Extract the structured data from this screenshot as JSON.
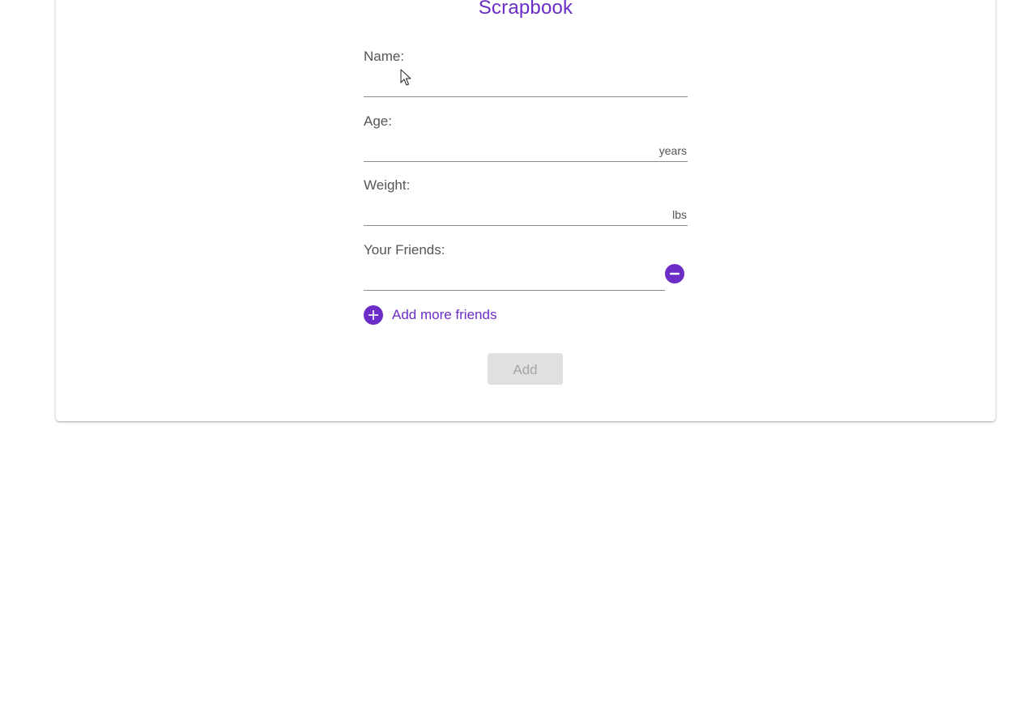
{
  "page_title": "Scrapbook",
  "form": {
    "name": {
      "label": "Name:",
      "value": ""
    },
    "age": {
      "label": "Age:",
      "value": "",
      "suffix": "years"
    },
    "weight": {
      "label": "Weight:",
      "value": "",
      "suffix": "lbs"
    },
    "friends": {
      "label": "Your Friends:",
      "items": [
        {
          "value": ""
        }
      ],
      "add_more_label": "Add more friends"
    },
    "submit_label": "Add",
    "submit_disabled": true
  },
  "colors": {
    "accent": "#6c2dc7",
    "label_text": "#555555",
    "disabled_button_bg": "#e0e0e0",
    "disabled_button_text": "#a6a6a6"
  },
  "icons": {
    "remove_friend": "minus-circle-icon",
    "add_friend": "plus-circle-icon",
    "cursor": "mouse-pointer-icon"
  }
}
